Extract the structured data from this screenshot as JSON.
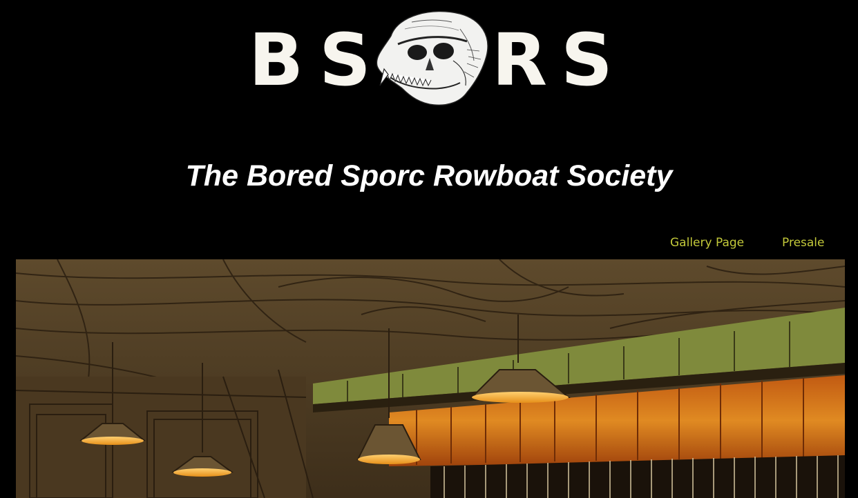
{
  "logo": {
    "letters": [
      "B",
      "S",
      "R",
      "S"
    ],
    "emblem_icon": "ape-skull-icon"
  },
  "site_title": "The Bored Sporc Rowboat Society",
  "nav": {
    "items": [
      {
        "label": "Gallery Page"
      },
      {
        "label": "Presale"
      }
    ]
  },
  "hero": {
    "illustration": "tavern-interior-illustration"
  },
  "colors": {
    "background": "#000000",
    "logo_text": "#f7f5ee",
    "nav_link": "#c3c93a",
    "title": "#ffffff"
  }
}
